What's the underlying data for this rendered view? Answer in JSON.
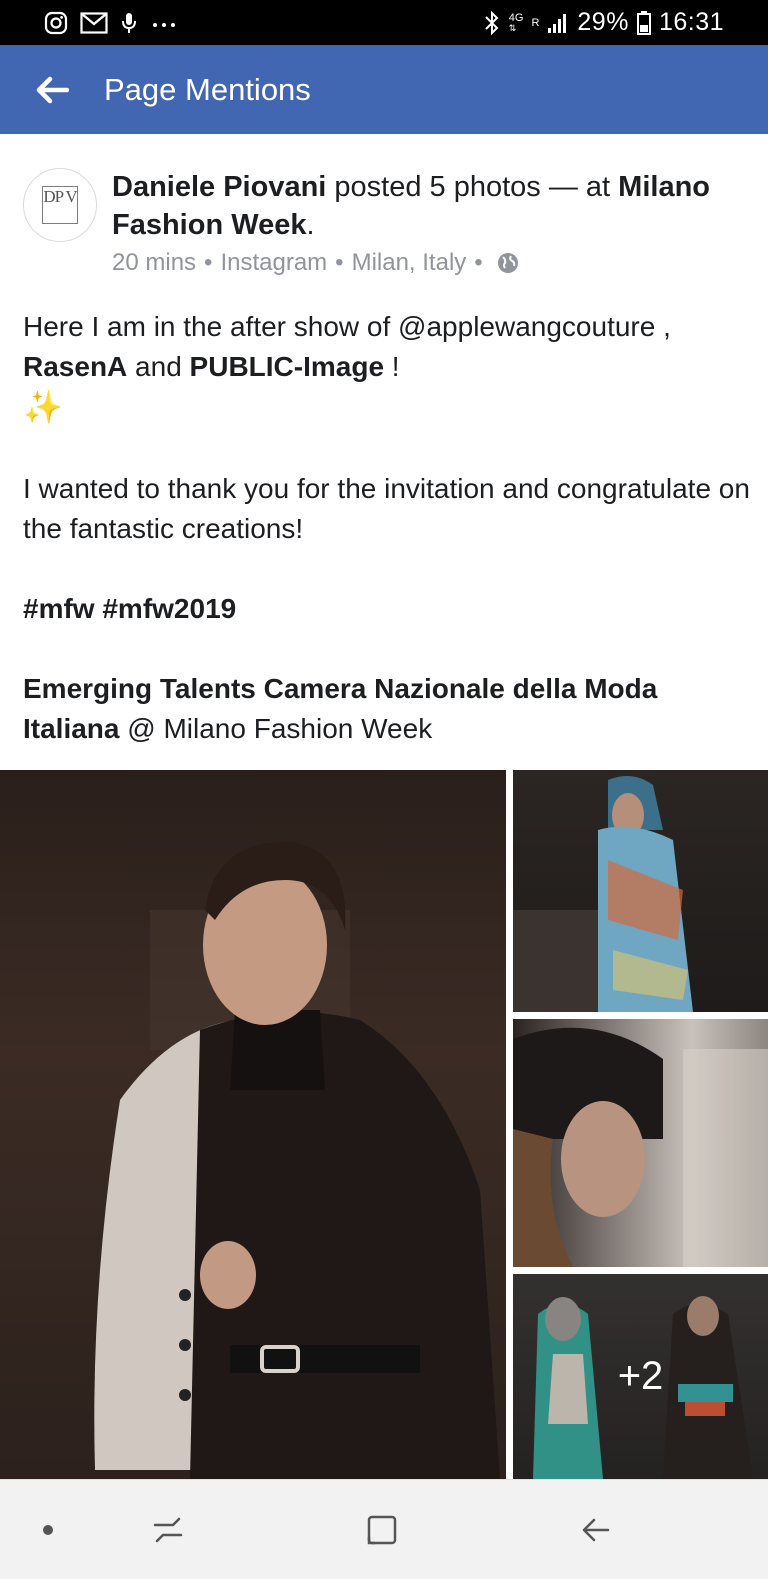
{
  "status_bar": {
    "network": "4G",
    "roaming": "R",
    "battery": "29%",
    "time": "16:31",
    "icons": [
      "instagram-icon",
      "gmail-icon",
      "microphone-icon",
      "more-dots-icon",
      "bluetooth-icon",
      "signal-icon",
      "battery-icon"
    ]
  },
  "app_bar": {
    "title": "Page Mentions"
  },
  "post": {
    "author": "Daniele Piovani",
    "action": " posted 5 photos — at ",
    "place": "Milano Fashion Week",
    "place_suffix": ".",
    "avatar_monogram": "DP V",
    "meta": {
      "time": "20 mins",
      "source": "Instagram",
      "location": "Milan, Italy",
      "separator": "•",
      "privacy": "globe-icon"
    },
    "body": {
      "p1_text1": "Here I am in the after show of @applewangcouture , ",
      "p1_tag1": "RasenA",
      "p1_text2": " and ",
      "p1_tag2": "PUBLIC-Image",
      "p1_text3": " !",
      "p1_emoji": "✨",
      "p2": "I wanted to thank you for the invitation and congratulate on the fantastic creations!",
      "p3": "#mfw #mfw2019",
      "p4_bold": "Emerging Talents Camera Nazionale della Moda Italiana",
      "p4_text": "  @ Milano Fashion Week"
    },
    "photos": {
      "more_count": "+2"
    }
  },
  "nav_bar": {
    "icons": [
      "dot-icon",
      "recent-apps-icon",
      "home-icon",
      "back-icon"
    ]
  },
  "colors": {
    "app_bar": "#4267b2",
    "text": "#1c1e21",
    "meta": "#90949c"
  }
}
